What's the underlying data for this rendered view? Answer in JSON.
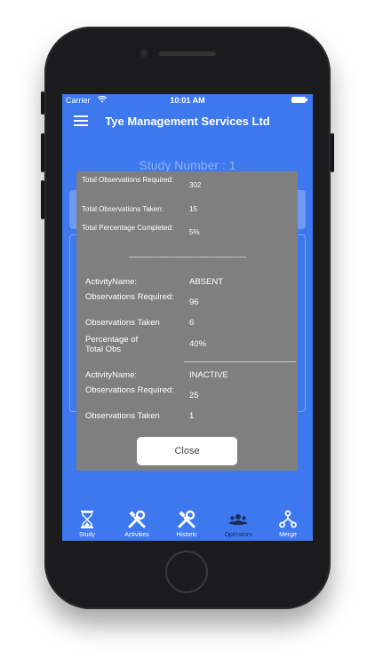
{
  "status_bar": {
    "carrier": "Carrier",
    "time": "10:01 AM"
  },
  "nav": {
    "title": "Tye Management Services Ltd"
  },
  "background": {
    "study_number": "Study Number :  1"
  },
  "summary": {
    "total_obs_required_label": "Total Observations Required:",
    "total_obs_required_value": "302",
    "total_obs_taken_label": "Total Observations Taken:",
    "total_obs_taken_value": "15",
    "total_pct_label": "Total Percentage Completed:",
    "total_pct_value": "5%"
  },
  "separator": "-----------------------------------------------------",
  "activities": [
    {
      "name_label": "ActivityName:",
      "name_value": "ABSENT",
      "req_label": "Observations Required:",
      "req_value": "96",
      "taken_label": "Observations Taken",
      "taken_value": "6",
      "pct_label": "Percentage of Total Obs",
      "pct_value": "40%"
    },
    {
      "name_label": "ActivityName:",
      "name_value": "INACTIVE",
      "req_label": "Observations Required:",
      "req_value": "25",
      "taken_label": "Observations Taken",
      "taken_value": "1"
    }
  ],
  "modal": {
    "close_label": "Close"
  },
  "tabs": [
    {
      "label": "Study",
      "icon": "hourglass-icon"
    },
    {
      "label": "Activities",
      "icon": "tools-icon"
    },
    {
      "label": "Historic",
      "icon": "tools-icon"
    },
    {
      "label": "Operators",
      "icon": "people-icon"
    },
    {
      "label": "Merge",
      "icon": "merge-icon"
    }
  ],
  "colors": {
    "screen_bg": "#3d78ee",
    "modal_bg": "#7f7f7f",
    "tab_active": "#1e2a5a"
  }
}
